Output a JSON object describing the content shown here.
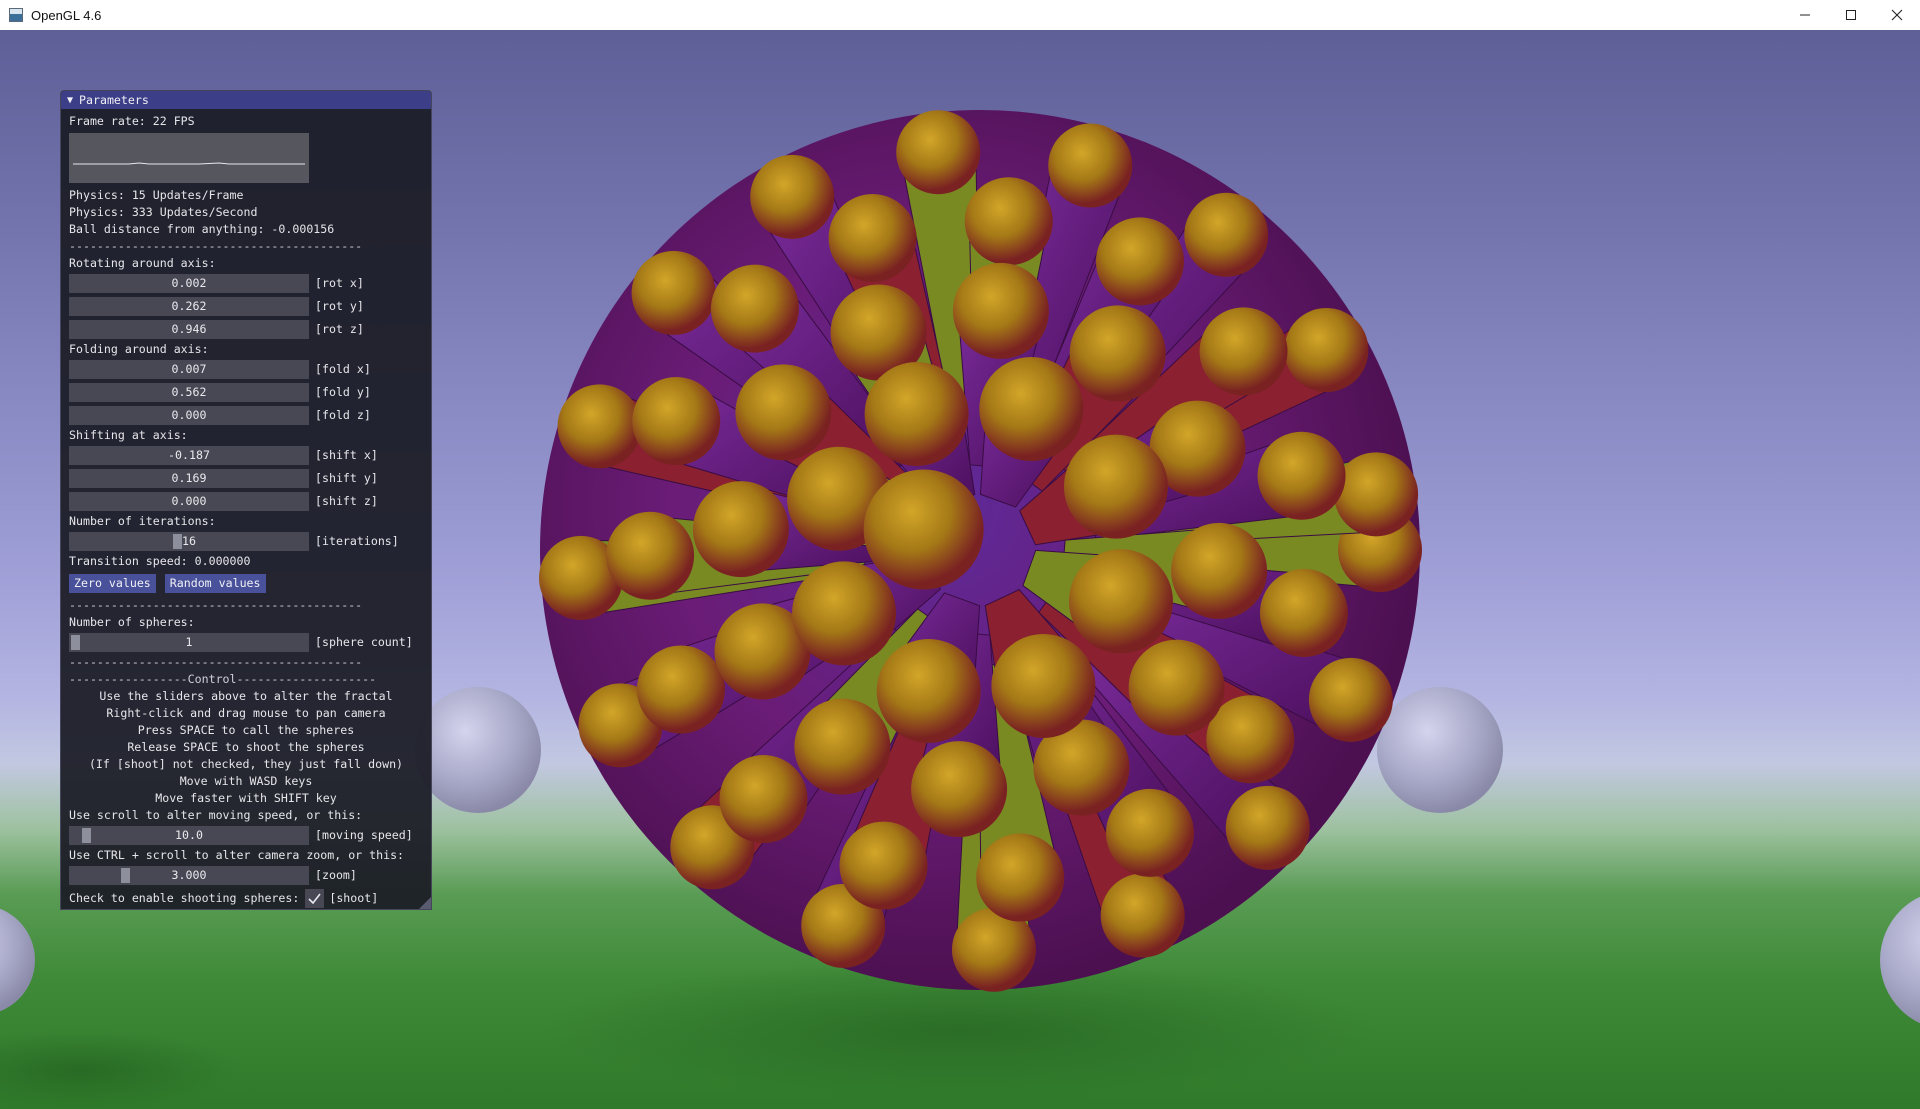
{
  "window": {
    "title": "OpenGL 4.6",
    "icon": "app-window-icon",
    "controls": [
      "minimize-icon",
      "maximize-icon",
      "close-icon"
    ]
  },
  "panel": {
    "header": "Parameters",
    "header_icon": "collapse-triangle-icon",
    "frame_rate": "Frame rate: 22 FPS",
    "physics_updates_frame": "Physics: 15 Updates/Frame",
    "physics_updates_second": "Physics: 333 Updates/Second",
    "ball_distance": "Ball distance from anything: -0.000156",
    "separator": "------------------------------------------",
    "rotating_heading": "Rotating around axis:",
    "rot_x": {
      "value": "0.002",
      "label": "[rot x]"
    },
    "rot_y": {
      "value": "0.262",
      "label": "[rot y]"
    },
    "rot_z": {
      "value": "0.946",
      "label": "[rot z]"
    },
    "folding_heading": "Folding around axis:",
    "fold_x": {
      "value": "0.007",
      "label": "[fold x]"
    },
    "fold_y": {
      "value": "0.562",
      "label": "[fold y]"
    },
    "fold_z": {
      "value": "0.000",
      "label": "[fold z]"
    },
    "shifting_heading": "Shifting at axis:",
    "shift_x": {
      "value": "-0.187",
      "label": "[shift x]"
    },
    "shift_y": {
      "value": "0.169",
      "label": "[shift y]"
    },
    "shift_z": {
      "value": "0.000",
      "label": "[shift z]"
    },
    "iterations_heading": "Number of iterations:",
    "iterations": {
      "value": "16",
      "label": "[iterations]",
      "level": 0.45
    },
    "transition_speed": "Transition speed: 0.000000",
    "zero_values_button": "Zero values",
    "random_values_button": "Random values",
    "spheres_heading": "Number of spheres:",
    "sphere_count": {
      "value": "1",
      "label": "[sphere count]",
      "level": 0.0
    },
    "control_separator": "-----------------Control--------------------",
    "instructions": [
      "Use the sliders above to alter the fractal",
      "Right-click and drag mouse to pan camera",
      "Press SPACE to call the spheres",
      "Release SPACE to shoot the spheres",
      "(If [shoot] not checked, they just fall down)",
      "Move with WASD keys",
      "Move faster with SHIFT key"
    ],
    "moving_speed_heading": "Use scroll to alter moving speed, or this:",
    "moving_speed": {
      "value": "10.0",
      "label": "[moving speed]",
      "level": 0.05
    },
    "zoom_heading": "Use CTRL + scroll to alter camera zoom, or this:",
    "zoom": {
      "value": "3.000",
      "label": "[zoom]",
      "level": 0.22
    },
    "shoot_heading": "Check to enable shooting spheres:",
    "shoot": {
      "label": "[shoot]",
      "checked": true
    }
  },
  "colors": {
    "panel_bg": "#1c1d26",
    "header_bg": "#3d3e88",
    "button_bg": "#49519a",
    "slider_bg": "#474853",
    "fractal_purple": "#6a1a78",
    "fractal_gold": "#b08a18",
    "fractal_green": "#6aa020"
  }
}
